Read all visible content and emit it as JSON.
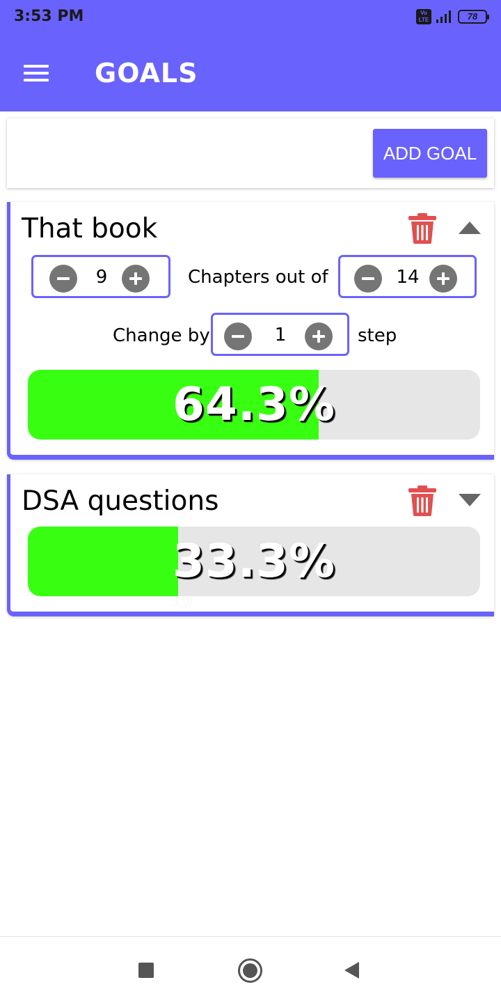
{
  "status_bar": {
    "time": "3:53 PM",
    "network_badge": "Vo LTE",
    "battery": "78"
  },
  "app_bar": {
    "title": "GOALS",
    "menu_icon": "hamburger-menu-icon"
  },
  "add_goal": {
    "button_label": "ADD GOAL"
  },
  "goals": [
    {
      "title": "That book",
      "expanded": true,
      "current": "9",
      "total": "14",
      "unit_label": "Chapters out of",
      "change_by_label": "Change by",
      "step": "1",
      "step_suffix": "step",
      "progress_fraction": 0.643,
      "progress_text": "64.3%"
    },
    {
      "title": "DSA questions",
      "expanded": false,
      "progress_fraction": 0.333,
      "progress_text": "33.3%"
    }
  ],
  "colors": {
    "accent": "#6a62fc",
    "progress_fill": "#38ff12",
    "progress_track": "#e6e6e6",
    "delete": "#e05050",
    "stepper_button": "#757575"
  },
  "icons": {
    "delete": "trash-icon",
    "collapse": "caret-up-icon",
    "expand": "caret-down-icon",
    "decrement": "minus-circle-icon",
    "increment": "plus-circle-icon",
    "nav_recents": "square-icon",
    "nav_home": "circle-icon",
    "nav_back": "triangle-back-icon"
  }
}
